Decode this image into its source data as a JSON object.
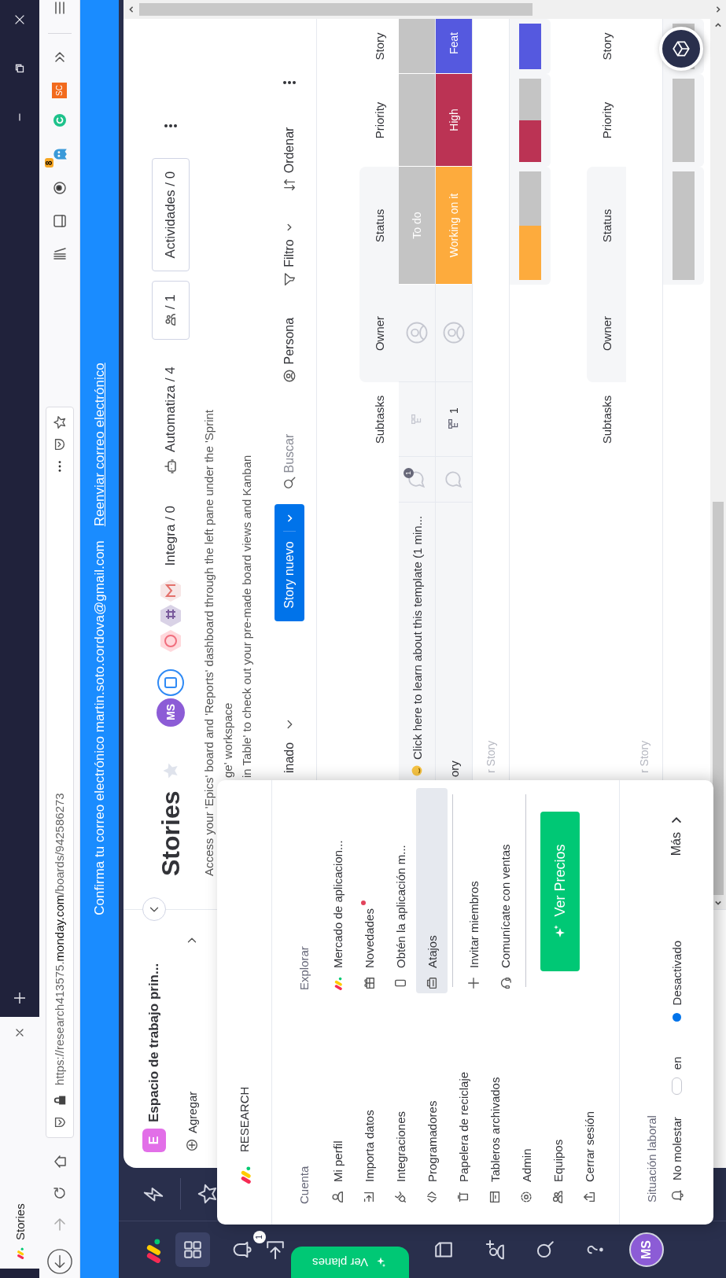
{
  "browser": {
    "tab_title": "Stories",
    "url_prefix": "https://research413575.",
    "url_domain": "monday.com",
    "url_path": "/boards/942586273",
    "extension_badge": "8",
    "extension_label": "SC"
  },
  "banner": {
    "message": "Confirma tu correo electrónico martin.soto.cordova@gmail.com",
    "link": "Reenviar correo electrónico"
  },
  "nav": {
    "badge": "1",
    "upgrade": "Ver planes",
    "avatar": "MS"
  },
  "workspace": {
    "letter": "E",
    "name": "Espacio de trabajo prin...",
    "add": "Agregar"
  },
  "board": {
    "title": "Stories",
    "starred": false,
    "avatar": "MS",
    "integrations": "Integra / 0",
    "automations": "Automatiza / 4",
    "members": "/ 1",
    "activity": "Actividades / 0",
    "description": [
      "Access your 'Epics' board and 'Reports' dashboard through the left pane under the 'Sprint",
      "ge' workspace",
      "in Table' to check out your pre-made board views and Kanban"
    ],
    "view": "inado",
    "new_item": "Story nuevo",
    "search": {
      "placeholder": "Buscar"
    },
    "person": "Persona",
    "filter": "Filtro",
    "sort": "Ordenar"
  },
  "table": {
    "groups": [
      {
        "columns": [
          "Subtasks",
          "Owner",
          "Status",
          "Priority",
          "Story"
        ],
        "rows": [
          {
            "name": "Click here to learn about this template (1 min...",
            "tip_icon": true,
            "comments": "1",
            "status": {
              "label": "To do",
              "color": "#c4c4c4"
            },
            "priority": {
              "color": "#c4c4c4"
            },
            "story": {
              "color": "#c4c4c4"
            }
          },
          {
            "name": "ory",
            "tip_icon": false,
            "subtasks": "1",
            "status": {
              "label": "Working on it",
              "color": "#fdab3d"
            },
            "priority": {
              "label": "High",
              "color": "#bb3354"
            },
            "story": {
              "label": "Feat",
              "color": "#5559df"
            }
          }
        ],
        "add_placeholder": "r Story",
        "summary": {
          "status": [
            {
              "color": "#fdab3d",
              "level": 0.5
            },
            {
              "color": "#c4c4c4",
              "level": 0.5
            }
          ],
          "priority": [
            {
              "color": "#bb3354",
              "level": 0.5
            },
            {
              "color": "#c4c4c4",
              "level": 0.5
            }
          ],
          "story": [
            {
              "color": "#5559df",
              "level": 1
            }
          ]
        }
      },
      {
        "columns": [
          "Subtasks",
          "Owner",
          "Status",
          "Priority",
          "Story"
        ],
        "add_placeholder": "r Story",
        "summary": {
          "status": [
            {
              "color": "#c4c4c4",
              "level": 1
            }
          ],
          "priority": [
            {
              "color": "#c4c4c4",
              "level": 1
            }
          ],
          "story": [
            {
              "color": "#c4c4c4",
              "level": 1
            }
          ]
        }
      }
    ]
  },
  "menu": {
    "org": "RESEARCH",
    "account_title": "Cuenta",
    "account_items": [
      {
        "label": "Mi perfil",
        "selected": false
      },
      {
        "label": "Importa datos",
        "selected": false
      },
      {
        "label": "Integraciones",
        "selected": false
      },
      {
        "label": "Programadores",
        "selected": false
      },
      {
        "label": "Papelera de reciclaje",
        "selected": false
      },
      {
        "label": "Tableros archivados",
        "selected": false
      },
      {
        "label": "Admin",
        "selected": false
      },
      {
        "label": "Equipos",
        "selected": false
      },
      {
        "label": "Cerrar sesión",
        "selected": false
      }
    ],
    "explore_title": "Explorar",
    "explore_items": [
      {
        "label": "Mercado de aplicacion...",
        "dot": false,
        "selected": false
      },
      {
        "label": "Novedades",
        "dot": true,
        "selected": false
      },
      {
        "label": "Obtén la aplicación m...",
        "dot": false,
        "selected": false
      },
      {
        "label": "Atajos",
        "dot": false,
        "selected": true
      }
    ],
    "contact_items": [
      {
        "label": "Invitar miembros",
        "selected": false
      },
      {
        "label": "Comunícate con ventas",
        "selected": false
      }
    ],
    "cta": "Ver Precios",
    "status_title": "Situación laboral",
    "dnd": {
      "label": "No molestar",
      "on": false,
      "on_label": "en",
      "state": "Desactivado"
    },
    "more": "Más"
  }
}
